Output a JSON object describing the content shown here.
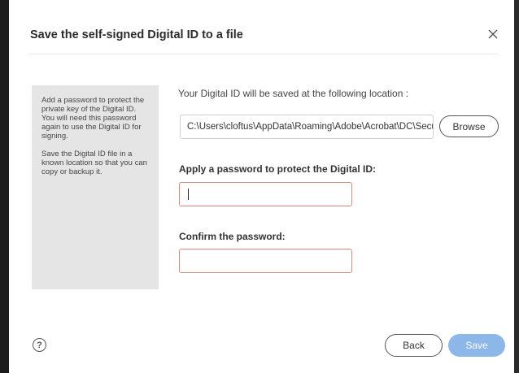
{
  "dialog": {
    "title": "Save the self-signed Digital ID to a file",
    "close_icon": "close-icon"
  },
  "side_panel": {
    "paragraph_1": "Add a password to protect the private key of the Digital ID. You will need this password again to use the Digital ID for signing.",
    "paragraph_2": "Save the Digital ID file in a known location so that you can copy or backup it."
  },
  "location": {
    "label": "Your Digital ID will be saved at the following location :",
    "path": "C:\\Users\\cloftus\\AppData\\Roaming\\Adobe\\Acrobat\\DC\\Security\\",
    "browse_label": "Browse"
  },
  "password": {
    "label": "Apply a password to protect the Digital ID:",
    "value": ""
  },
  "confirm": {
    "label": "Confirm the password:",
    "value": ""
  },
  "footer": {
    "help_label": "?",
    "back_label": "Back",
    "save_label": "Save"
  },
  "colors": {
    "save_button_disabled": "#8db7e8",
    "input_border_error": "#d9897e",
    "side_panel_bg": "#e5e5e5"
  }
}
